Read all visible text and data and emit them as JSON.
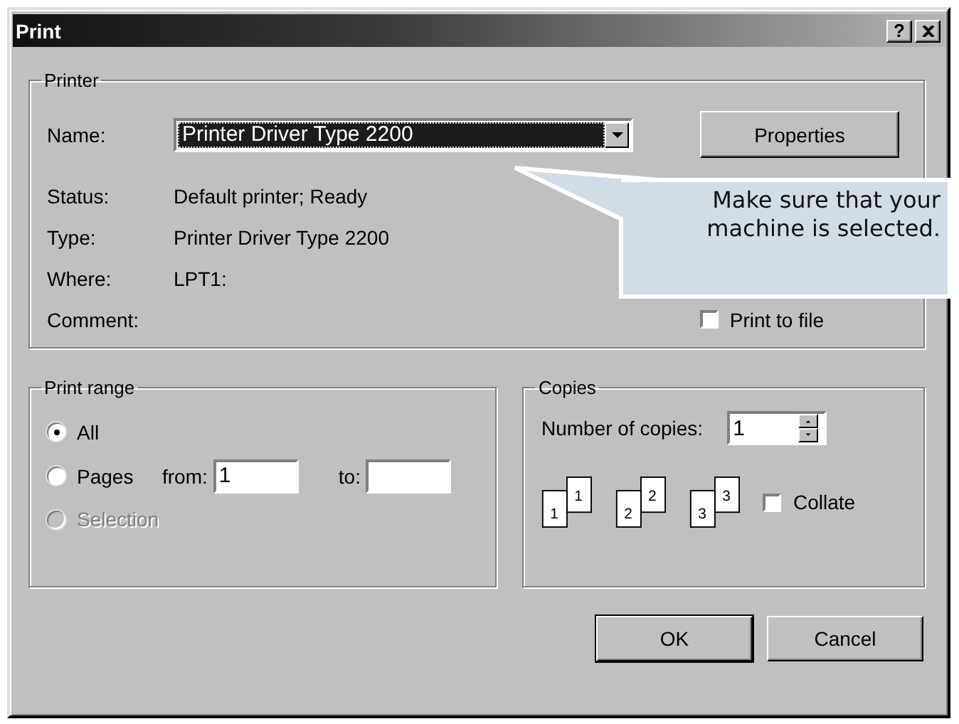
{
  "window": {
    "title": "Print",
    "help_button": "?"
  },
  "printer": {
    "legend": "Printer",
    "name_label": "Name:",
    "selected_printer": "Printer Driver Type 2200",
    "properties_button": "Properties",
    "info": [
      {
        "label": "Status:",
        "value": "Default printer; Ready"
      },
      {
        "label": "Type:",
        "value": "Printer Driver Type 2200"
      },
      {
        "label": "Where:",
        "value": "LPT1:"
      },
      {
        "label": "Comment:"
      }
    ],
    "print_to_file": {
      "label": "Print to file",
      "checked": false
    }
  },
  "print_range": {
    "legend": "Print range",
    "options": [
      {
        "label": "All",
        "selected": true,
        "disabled": false
      },
      {
        "label": "Pages",
        "selected": false,
        "disabled": false
      },
      {
        "label": "Selection",
        "selected": false,
        "disabled": true
      }
    ],
    "from_label": "from:",
    "from_value": "1",
    "to_label": "to:"
  },
  "copies": {
    "legend": "Copies",
    "number_label": "Number of copies:",
    "number_value": "1",
    "stacks": [
      {
        "front": "1",
        "back": "1"
      },
      {
        "front": "2",
        "back": "2"
      },
      {
        "front": "3",
        "back": "3"
      }
    ],
    "collate": {
      "label": "Collate",
      "checked": false
    }
  },
  "buttons": [
    {
      "label": "OK",
      "default": true
    },
    {
      "label": "Cancel",
      "default": false
    }
  ],
  "callout": {
    "text": "Make sure that your machine is selected."
  }
}
